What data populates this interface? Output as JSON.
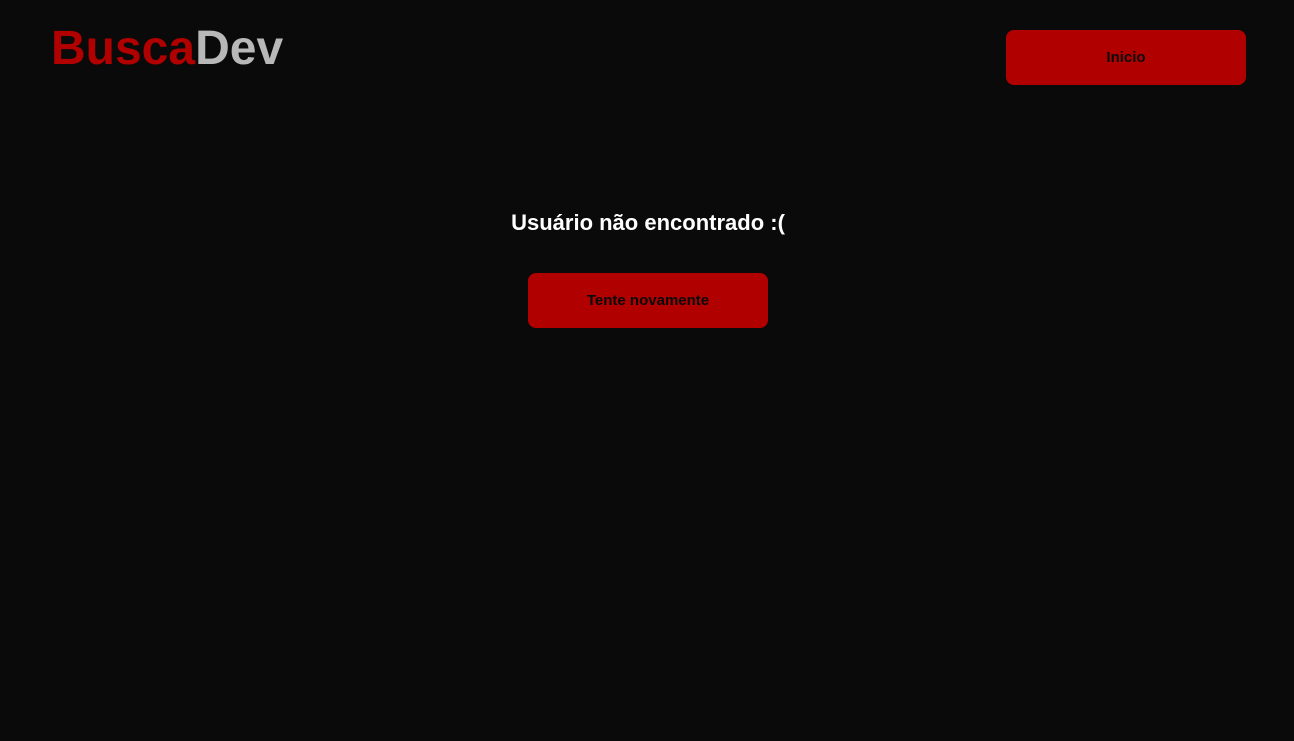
{
  "header": {
    "logo_part_1": "Busca",
    "logo_part_2": "Dev",
    "home_button_label": "Inicio"
  },
  "main": {
    "message": "Usuário não encontrado :(",
    "retry_button_label": "Tente novamente"
  },
  "colors": {
    "background": "#0a0a0a",
    "accent": "#b00000",
    "logo_secondary": "#b8b8b8",
    "text": "#ffffff"
  }
}
